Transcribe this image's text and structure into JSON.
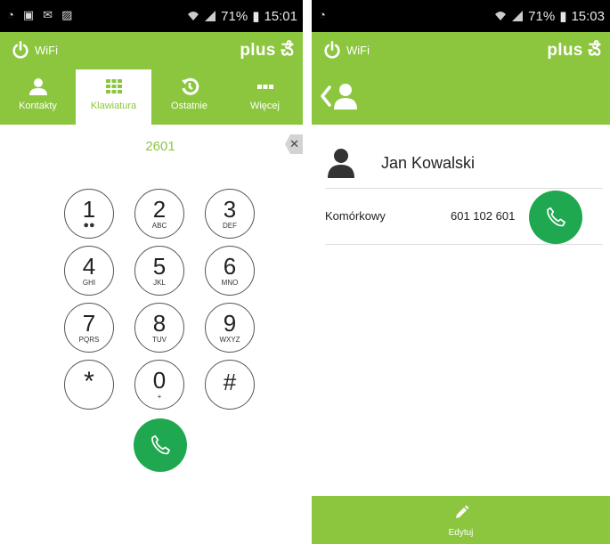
{
  "left": {
    "status": {
      "battery": "71%",
      "time": "15:01"
    },
    "appbar": {
      "wifi_label": "WiFi",
      "brand": "plus"
    },
    "tabs": [
      {
        "label": "Kontakty",
        "icon": "person-icon"
      },
      {
        "label": "Klawiatura",
        "icon": "keypad-icon"
      },
      {
        "label": "Ostatnie",
        "icon": "history-icon"
      },
      {
        "label": "Więcej",
        "icon": "more-icon"
      }
    ],
    "active_tab": "Klawiatura",
    "dialed_number": "2601",
    "keys": [
      {
        "digit": "1",
        "letters": "●●"
      },
      {
        "digit": "2",
        "letters": "ABC"
      },
      {
        "digit": "3",
        "letters": "DEF"
      },
      {
        "digit": "4",
        "letters": "GHI"
      },
      {
        "digit": "5",
        "letters": "JKL"
      },
      {
        "digit": "6",
        "letters": "MNO"
      },
      {
        "digit": "7",
        "letters": "PQRS"
      },
      {
        "digit": "8",
        "letters": "TUV"
      },
      {
        "digit": "9",
        "letters": "WXYZ"
      },
      {
        "digit": "*",
        "letters": ""
      },
      {
        "digit": "0",
        "letters": "+"
      },
      {
        "digit": "#",
        "letters": ""
      }
    ]
  },
  "right": {
    "status": {
      "battery": "71%",
      "time": "15:03"
    },
    "appbar": {
      "wifi_label": "WiFi",
      "brand": "plus"
    },
    "contact": {
      "name": "Jan Kowalski"
    },
    "phone": {
      "type": "Komórkowy",
      "number": "601 102 601"
    },
    "bottom_action": "Edytuj"
  },
  "colors": {
    "accent": "#8cc63f",
    "call": "#1fa84f",
    "statusbar": "#000000"
  }
}
